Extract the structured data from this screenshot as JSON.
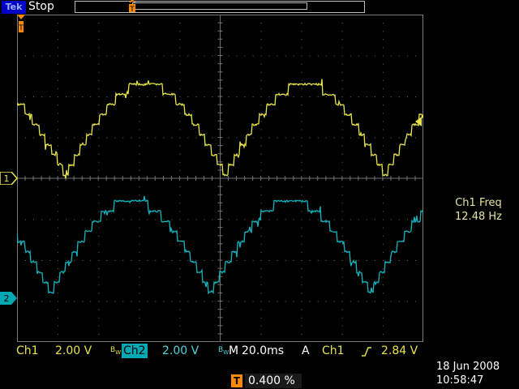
{
  "header": {
    "brand": "Tek",
    "run_state": "Stop"
  },
  "channels": {
    "ch1": {
      "marker": "1",
      "label": "Ch1",
      "scale": "2.00 V",
      "bw_mark": "B",
      "color": "#e8e44a"
    },
    "ch2": {
      "marker": "2",
      "label": "Ch2",
      "scale": "2.00 V",
      "bw_mark": "B",
      "color": "#00a8b4"
    }
  },
  "horizontal": {
    "mode": "M",
    "timebase": "20.0ms"
  },
  "acquisition": {
    "mode": "A"
  },
  "trigger": {
    "source": "Ch1",
    "level": "2.84 V",
    "slope_icon": "rising-edge-icon",
    "position_icon": "T",
    "position": "0.400 %"
  },
  "measurement": {
    "label": "Ch1 Freq",
    "value": "12.48 Hz"
  },
  "timestamp": {
    "date": "18 Jun  2008",
    "time": "10:58:47"
  },
  "colors": {
    "graticule": "#7a7a7a",
    "trigger_marker": "#ff8a00",
    "brand_bg": "#0000c8"
  }
}
